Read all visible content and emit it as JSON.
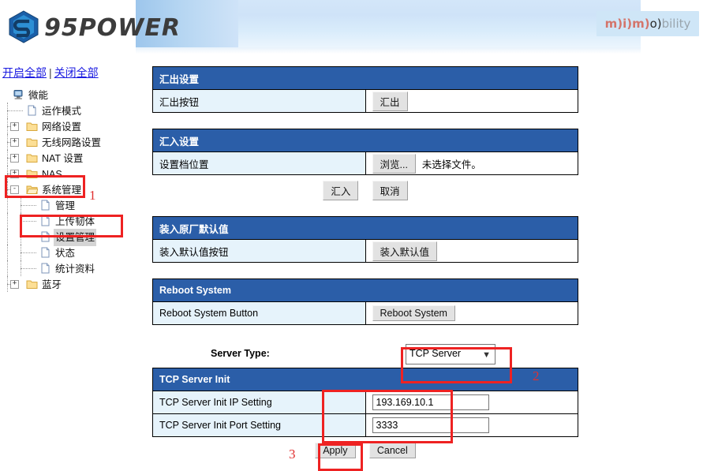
{
  "header": {
    "brand_text": "95POWER",
    "logo_icon": "hexagon-s-logo-icon",
    "partner_logo": {
      "p1": "m)",
      "p2": "i)",
      "p3": "m)",
      "p4": "o)",
      "p5": "bility"
    }
  },
  "sidebar": {
    "expand_all": "开启全部",
    "separator": "|",
    "collapse_all": "关闭全部",
    "tree": [
      {
        "label": "微能",
        "icon": "computer-icon",
        "depth": 0,
        "expander": "",
        "selected": false
      },
      {
        "label": "运作模式",
        "icon": "page-icon",
        "depth": 1,
        "expander": "",
        "selected": false
      },
      {
        "label": "网络设置",
        "icon": "folder-icon",
        "depth": 1,
        "expander": "+",
        "selected": false
      },
      {
        "label": "无线网路设置",
        "icon": "folder-icon",
        "depth": 1,
        "expander": "+",
        "selected": false
      },
      {
        "label": "NAT 设置",
        "icon": "folder-icon",
        "depth": 1,
        "expander": "+",
        "selected": false
      },
      {
        "label": "NAS",
        "icon": "folder-icon",
        "depth": 1,
        "expander": "+",
        "selected": false
      },
      {
        "label": "系统管理",
        "icon": "folder-open-icon",
        "depth": 1,
        "expander": "-",
        "selected": false
      },
      {
        "label": "管理",
        "icon": "page-icon",
        "depth": 2,
        "expander": "",
        "selected": false
      },
      {
        "label": "上传韧体",
        "icon": "page-icon",
        "depth": 2,
        "expander": "",
        "selected": false
      },
      {
        "label": "设置管理",
        "icon": "page-icon",
        "depth": 2,
        "expander": "",
        "selected": true
      },
      {
        "label": "状态",
        "icon": "page-icon",
        "depth": 2,
        "expander": "",
        "selected": false
      },
      {
        "label": "统计资料",
        "icon": "page-icon",
        "depth": 2,
        "expander": "",
        "selected": false
      },
      {
        "label": "蓝牙",
        "icon": "folder-icon",
        "depth": 1,
        "expander": "+",
        "selected": false
      }
    ]
  },
  "main": {
    "export_panel": {
      "title": "汇出设置",
      "row_label": "汇出按钮",
      "button": "汇出"
    },
    "import_panel": {
      "title": "汇入设置",
      "row_label": "设置档位置",
      "browse_button": "浏览...",
      "file_status": "未选择文件。",
      "submit_button": "汇入",
      "cancel_button": "取消"
    },
    "defaults_panel": {
      "title": "装入原厂默认值",
      "row_label": "装入默认值按钮",
      "button": "装入默认值"
    },
    "reboot_panel": {
      "title": "Reboot System",
      "row_label": "Reboot System Button",
      "button": "Reboot System"
    },
    "server_type": {
      "label": "Server Type:",
      "selected": "TCP Server",
      "options": [
        "TCP Server"
      ],
      "chevron": "chevron-down-icon"
    },
    "tcp_panel": {
      "title": "TCP Server Init",
      "ip_label": "TCP Server Init IP Setting",
      "ip_value": "193.169.10.1",
      "port_label": "TCP Server Init Port Setting",
      "port_value": "3333",
      "apply_button": "Apply",
      "cancel_button": "Cancel"
    }
  },
  "annotations": {
    "color": "#ee2222",
    "steps": [
      {
        "num": "1",
        "target": "sidebar-system-management"
      },
      {
        "num": "2",
        "target": "server-type-select"
      },
      {
        "num": "3",
        "target": "apply-button"
      }
    ]
  }
}
